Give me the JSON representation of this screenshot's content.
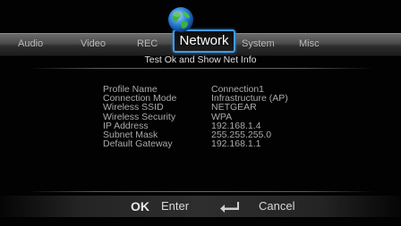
{
  "tabs": [
    {
      "label": "Audio"
    },
    {
      "label": "Video"
    },
    {
      "label": "REC"
    },
    {
      "label": "Network",
      "active": true
    },
    {
      "label": "System"
    },
    {
      "label": "Misc"
    }
  ],
  "subtitle": "Test Ok and Show Net Info",
  "info": [
    {
      "label": "Profile Name",
      "value": "Connection1"
    },
    {
      "label": "Connection Mode",
      "value": "Infrastructure (AP)"
    },
    {
      "label": "Wireless SSID",
      "value": "NETGEAR"
    },
    {
      "label": "Wireless Security",
      "value": "WPA"
    },
    {
      "label": "IP Address",
      "value": "192.168.1.4"
    },
    {
      "label": "Subnet Mask",
      "value": "255.255.255.0"
    },
    {
      "label": "Default Gateway",
      "value": "192.168.1.1"
    }
  ],
  "footer": {
    "ok_key": "OK",
    "ok_action": "Enter",
    "cancel_action": "Cancel"
  },
  "icons": {
    "network_tab": "globe-icon",
    "cancel_key": "return-arrow-icon"
  },
  "colors": {
    "active_tab_border": "#3f9be6",
    "text": "#aaaaaa"
  }
}
